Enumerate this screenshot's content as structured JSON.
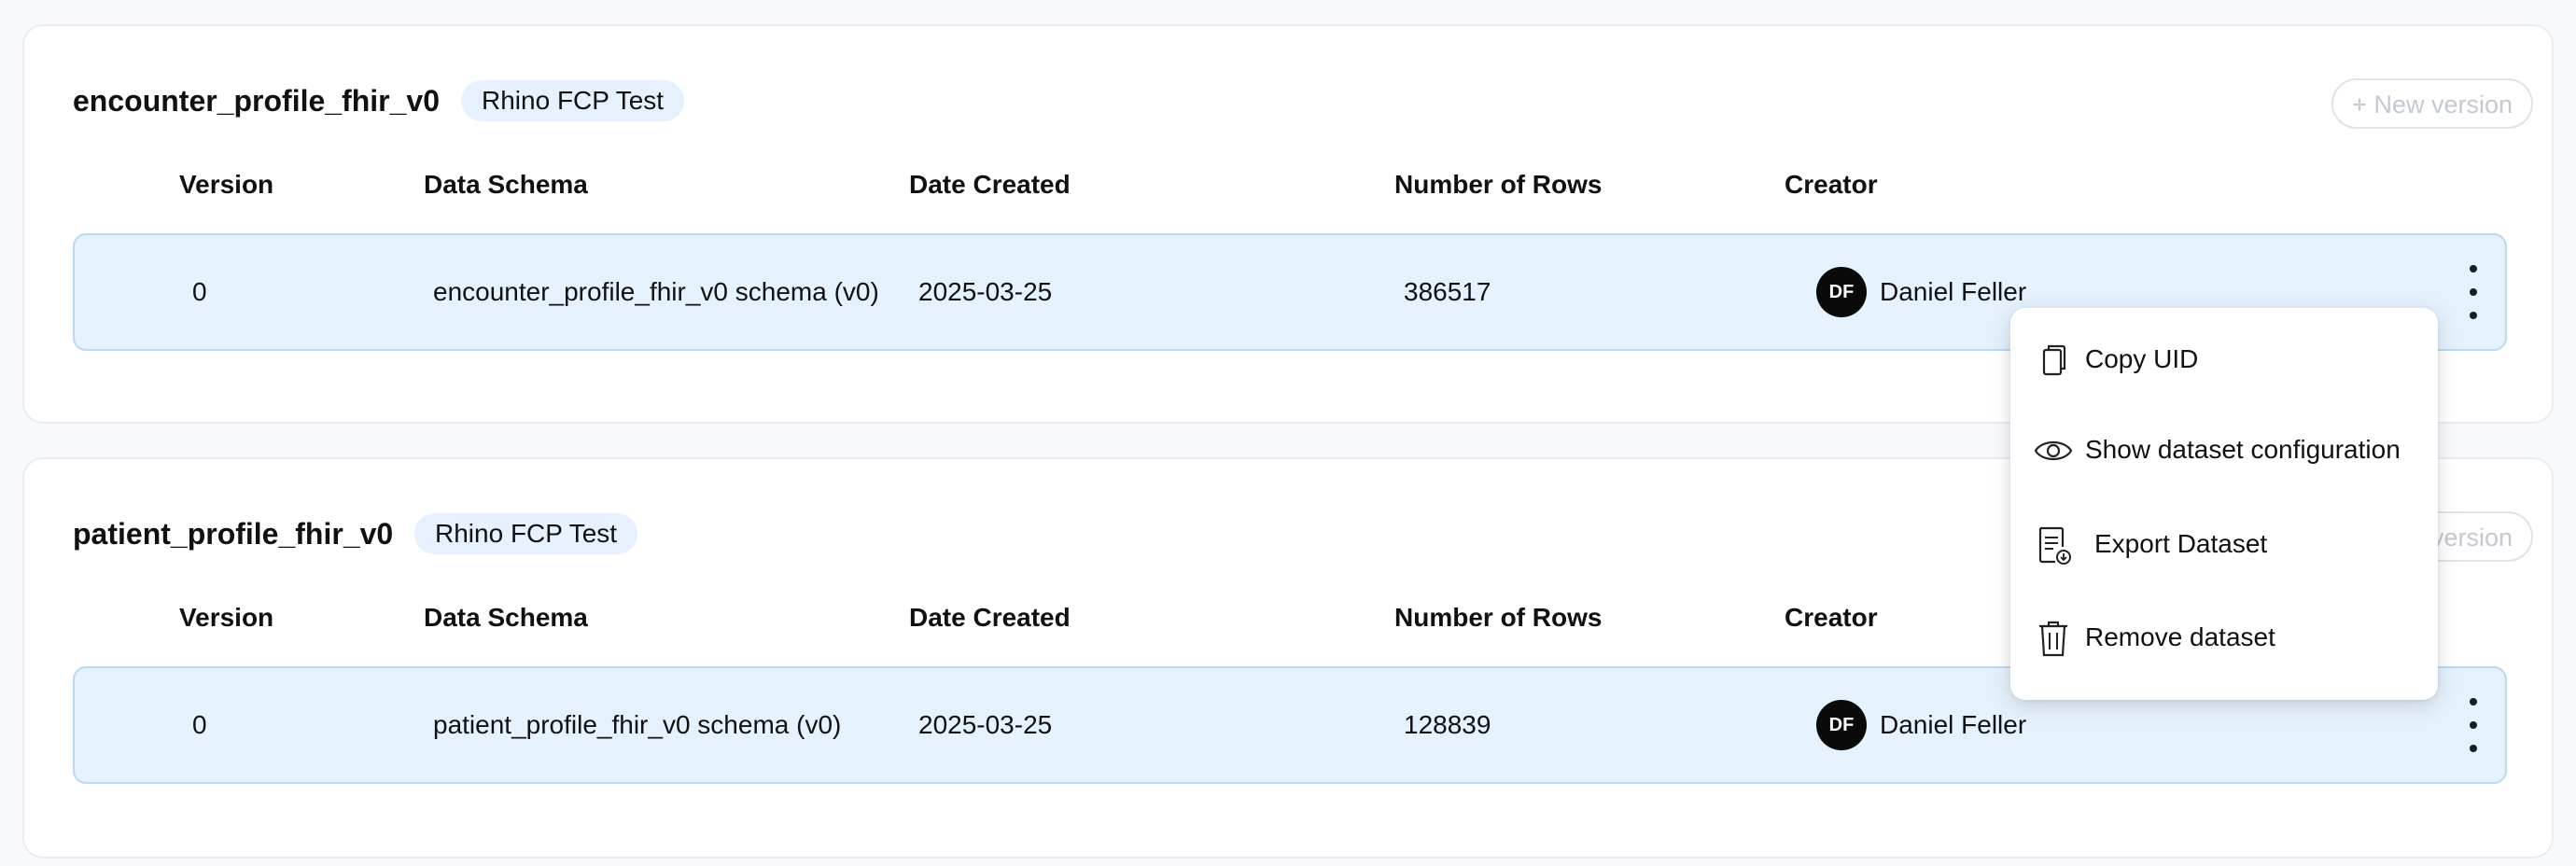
{
  "datasets": [
    {
      "title": "encounter_profile_fhir_v0",
      "tag": "Rhino FCP Test",
      "new_version_label": "+ New version",
      "columns": [
        "Version",
        "Data Schema",
        "Date Created",
        "Number of Rows",
        "Creator"
      ],
      "row": {
        "version": "0",
        "schema": "encounter_profile_fhir_v0 schema (v0)",
        "date": "2025-03-25",
        "rows": "386517",
        "creator_initials": "DF",
        "creator": "Daniel Feller"
      }
    },
    {
      "title": "patient_profile_fhir_v0",
      "tag": "Rhino FCP Test",
      "new_version_label": "+ New version",
      "columns": [
        "Version",
        "Data Schema",
        "Date Created",
        "Number of Rows",
        "Creator"
      ],
      "row": {
        "version": "0",
        "schema": "patient_profile_fhir_v0 schema (v0)",
        "date": "2025-03-25",
        "rows": "128839",
        "creator_initials": "DF",
        "creator": "Daniel Feller"
      }
    }
  ],
  "context_menu": {
    "items": [
      {
        "label": "Copy UID",
        "icon": "copy-icon"
      },
      {
        "label": "Show dataset configuration",
        "icon": "eye-icon"
      },
      {
        "label": "Export Dataset",
        "icon": "export-document-icon"
      },
      {
        "label": "Remove dataset",
        "icon": "trash-icon"
      }
    ]
  },
  "colors": {
    "row_background": "#e5f1fc",
    "row_border": "#b9d9f4",
    "tag_background": "#e6f1fd",
    "avatar_background": "#0a0a0a"
  }
}
